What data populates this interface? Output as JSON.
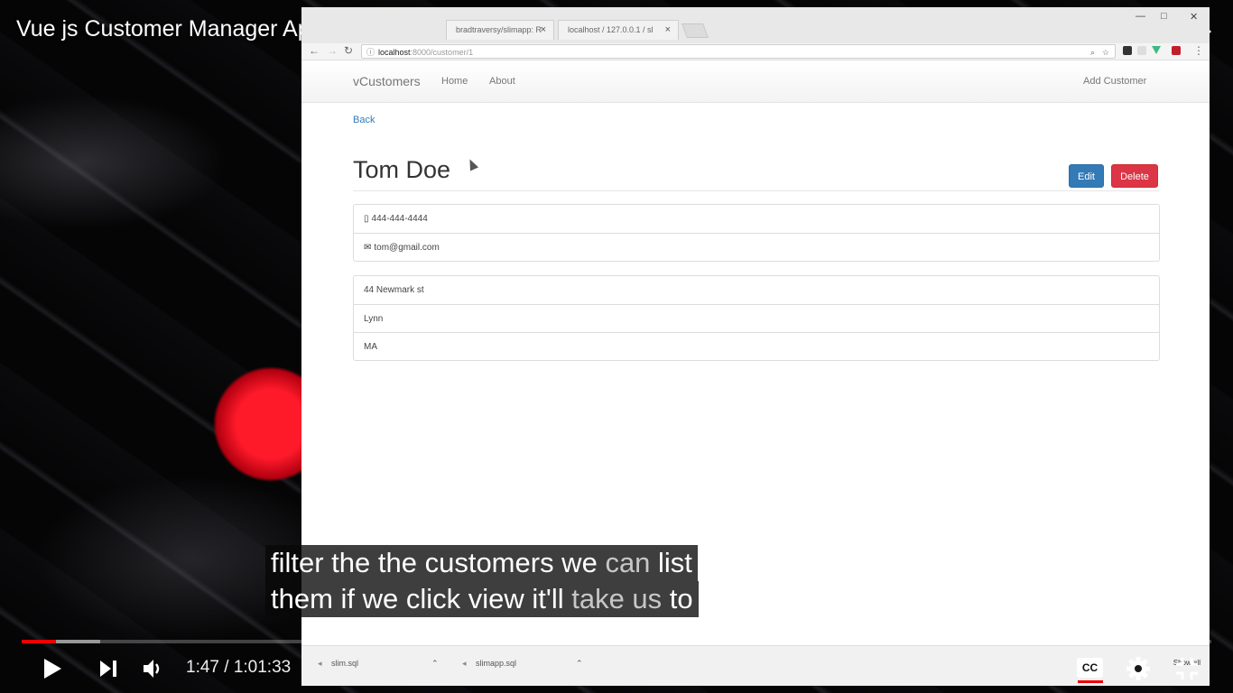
{
  "player": {
    "video_title": "Vue js Customer Manager App Frontend",
    "current_time": "1:47",
    "separator": "/",
    "duration": "1:01:33",
    "played_fraction": 0.029,
    "buffered_fraction": 0.066,
    "captions": [
      {
        "segments": [
          {
            "text": "filter the the customers we ",
            "dim": false
          },
          {
            "text": "can",
            "dim": true
          },
          {
            "text": " list",
            "dim": false
          }
        ]
      },
      {
        "segments": [
          {
            "text": "them if we click view it'll ",
            "dim": false
          },
          {
            "text": "take us",
            "dim": true
          },
          {
            "text": " to",
            "dim": false
          }
        ]
      }
    ],
    "icons": {
      "watch_later": "clock-icon",
      "share": "share-icon",
      "play": "play-icon",
      "next": "skip-next-icon",
      "volume": "volume-icon",
      "captions": "closed-captions-icon",
      "settings": "gear-icon",
      "exit_fullscreen": "exit-fullscreen-icon"
    },
    "cc_label": "CC",
    "accent_color": "#ee0000"
  },
  "browser": {
    "tabs": [
      {
        "label": "bradtraversy/slimapp: R"
      },
      {
        "label": "localhost / 127.0.0.1 / sl"
      }
    ],
    "address": {
      "host": "localhost",
      "path": ":8000/customer/1"
    },
    "downloads": [
      {
        "label": "slim.sql"
      },
      {
        "label": "slimapp.sql"
      }
    ],
    "show_all_label": "Show all"
  },
  "app": {
    "brand": "vCustomers",
    "nav": {
      "home": "Home",
      "about": "About",
      "add_customer": "Add Customer"
    },
    "back_label": "Back",
    "customer": {
      "name": "Tom Doe",
      "phone": "444-444-4444",
      "email": "tom@gmail.com",
      "address": "44 Newmark st",
      "city": "Lynn",
      "state": "MA"
    },
    "edit_label": "Edit",
    "delete_label": "Delete",
    "colors": {
      "primary": "#337ab7",
      "danger": "#dc3545"
    }
  }
}
